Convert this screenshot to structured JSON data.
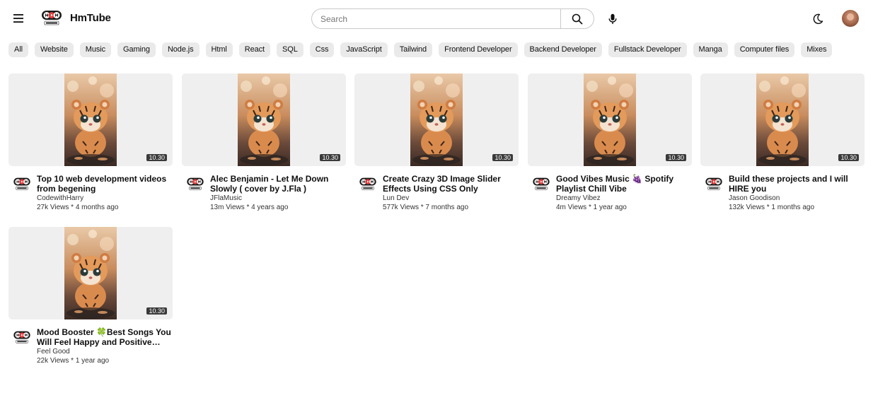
{
  "header": {
    "app_name": "HmTube",
    "search_placeholder": "Search"
  },
  "chips": [
    "All",
    "Website",
    "Music",
    "Gaming",
    "Node.js",
    "Html",
    "React",
    "SQL",
    "Css",
    "JavaScript",
    "Tailwind",
    "Frontend Developer",
    "Backend Developer",
    "Fullstack Developer",
    "Manga",
    "Computer files",
    "Mixes"
  ],
  "videos": [
    {
      "title": "Top 10 web development videos from begening",
      "channel": "CodewithHarry",
      "stats": "27k Views * 4 months ago",
      "duration": "10.30"
    },
    {
      "title": "Alec Benjamin - Let Me Down Slowly ( cover by J.Fla )",
      "channel": "JFlaMusic",
      "stats": "13m Views * 4 years ago",
      "duration": "10.30"
    },
    {
      "title": "Create Crazy 3D Image Slider Effects Using CSS Only",
      "channel": "Lun Dev",
      "stats": "577k Views * 7 months ago",
      "duration": "10.30"
    },
    {
      "title": "Good Vibes Music 🍇 Spotify Playlist Chill Vibe",
      "channel": "Dreamy Vibez",
      "stats": "4m Views * 1 year ago",
      "duration": "10.30"
    },
    {
      "title": "Build these projects and I will HIRE you",
      "channel": "Jason Goodison",
      "stats": "132k Views * 1 months ago",
      "duration": "10.30"
    },
    {
      "title": "Mood Booster 🍀Best Songs You Will Feel Happy and Positive After Listening",
      "channel": "Feel Good",
      "stats": "22k Views * 1 year ago",
      "duration": "10.30"
    }
  ],
  "icons": {
    "menu": "menu-icon",
    "search": "search-icon",
    "mic": "mic-icon",
    "theme": "moon-icon"
  },
  "colors": {
    "chip_bg": "#eaeaea",
    "thumb_bg": "#efefef",
    "logo_red": "#e23b3b"
  }
}
